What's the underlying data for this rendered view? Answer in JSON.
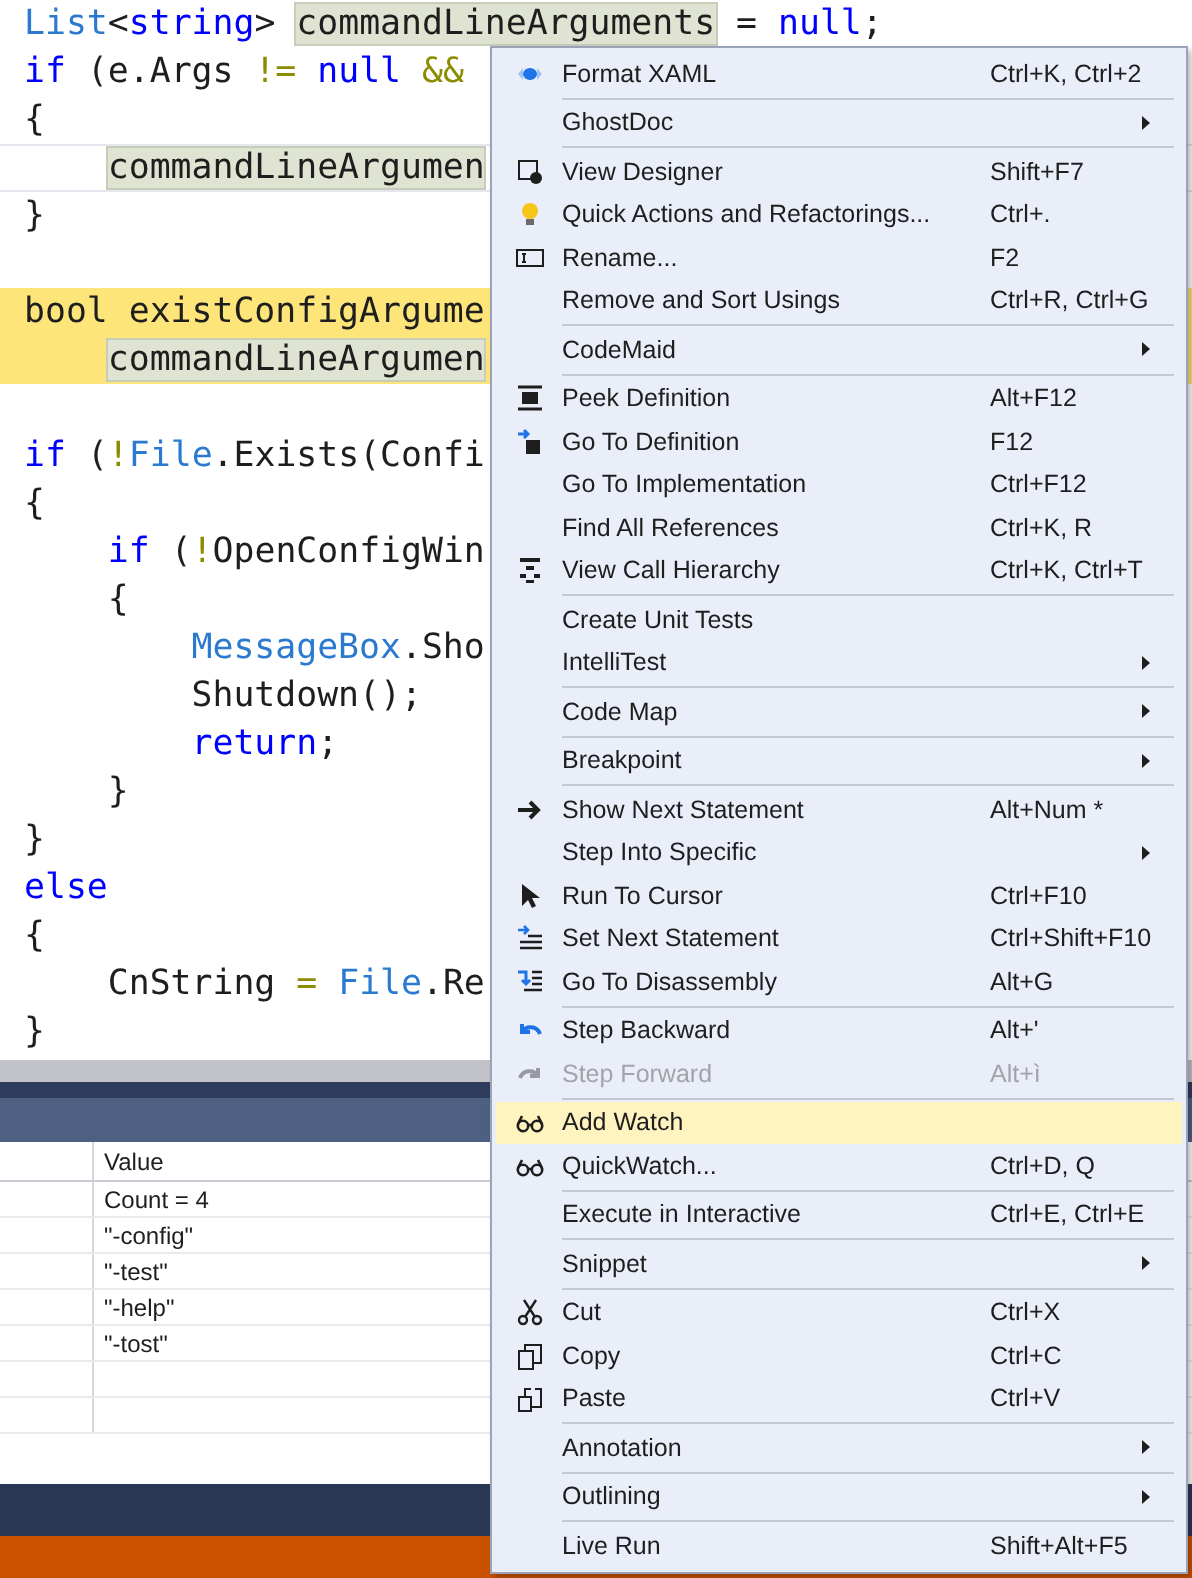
{
  "code_lines": [
    {
      "kind": "normal",
      "tokens": [
        {
          "text": "List",
          "kind": "type"
        },
        {
          "text": "<",
          "kind": "plain"
        },
        {
          "text": "string",
          "kind": "keyword"
        },
        {
          "text": "> ",
          "kind": "plain"
        },
        {
          "text": "commandLineArguments",
          "kind": "reference"
        },
        {
          "text": " = ",
          "kind": "plain"
        },
        {
          "text": "null",
          "kind": "keyword"
        },
        {
          "text": ";",
          "kind": "plain"
        }
      ]
    },
    {
      "kind": "normal",
      "tokens": [
        {
          "text": "if",
          "kind": "keyword"
        },
        {
          "text": " (e.Args ",
          "kind": "plain"
        },
        {
          "text": "!=",
          "kind": "operator"
        },
        {
          "text": " null ",
          "kind": "keyword"
        },
        {
          "text": "&&",
          "kind": "operator"
        }
      ]
    },
    {
      "kind": "normal",
      "tokens": [
        {
          "text": "{",
          "kind": "plain"
        }
      ]
    },
    {
      "kind": "caret",
      "tokens": [
        {
          "text": "    commandLineArgumen",
          "kind": "reference"
        }
      ]
    },
    {
      "kind": "normal",
      "tokens": [
        {
          "text": "}",
          "kind": "plain"
        }
      ]
    },
    {
      "kind": "normal"
    },
    {
      "kind": "breakpoint",
      "tokens": [
        {
          "text": "bool existConfigArgume",
          "kind": "plain"
        }
      ]
    },
    {
      "kind": "breakpoint",
      "tokens": [
        {
          "text": "    commandLineArgumen",
          "kind": "reference"
        }
      ]
    },
    {
      "kind": "normal"
    },
    {
      "kind": "normal",
      "tokens": [
        {
          "text": "if",
          "kind": "keyword"
        },
        {
          "text": " (",
          "kind": "plain"
        },
        {
          "text": "!",
          "kind": "operator"
        },
        {
          "text": "File",
          "kind": "type"
        },
        {
          "text": ".Exists(Confi",
          "kind": "plain"
        }
      ]
    },
    {
      "kind": "normal",
      "tokens": [
        {
          "text": "{",
          "kind": "plain"
        }
      ]
    },
    {
      "kind": "normal",
      "tokens": [
        {
          "text": "    if",
          "kind": "keyword"
        },
        {
          "text": " (",
          "kind": "plain"
        },
        {
          "text": "!",
          "kind": "operator"
        },
        {
          "text": "OpenConfigWin",
          "kind": "plain"
        }
      ]
    },
    {
      "kind": "normal",
      "tokens": [
        {
          "text": "    {",
          "kind": "plain"
        }
      ]
    },
    {
      "kind": "normal",
      "tokens": [
        {
          "text": "        MessageBox",
          "kind": "type"
        },
        {
          "text": ".Sho",
          "kind": "plain"
        }
      ]
    },
    {
      "kind": "normal",
      "tokens": [
        {
          "text": "        Shutdown();",
          "kind": "plain"
        }
      ]
    },
    {
      "kind": "normal",
      "tokens": [
        {
          "text": "        return",
          "kind": "keyword"
        },
        {
          "text": ";",
          "kind": "plain"
        }
      ]
    },
    {
      "kind": "normal",
      "tokens": [
        {
          "text": "    }",
          "kind": "plain"
        }
      ]
    },
    {
      "kind": "normal",
      "tokens": [
        {
          "text": "}",
          "kind": "plain"
        }
      ]
    },
    {
      "kind": "normal",
      "tokens": [
        {
          "text": "else",
          "kind": "keyword"
        }
      ]
    },
    {
      "kind": "normal",
      "tokens": [
        {
          "text": "{",
          "kind": "plain"
        }
      ]
    },
    {
      "kind": "normal",
      "tokens": [
        {
          "text": "    CnString ",
          "kind": "plain"
        },
        {
          "text": "=",
          "kind": "operator"
        },
        {
          "text": " File",
          "kind": "type"
        },
        {
          "text": ".Re",
          "kind": "plain"
        }
      ]
    },
    {
      "kind": "normal",
      "tokens": [
        {
          "text": "}",
          "kind": "plain"
        }
      ]
    }
  ],
  "watch": {
    "columns": [
      "Value"
    ],
    "rows": [
      "Count = 4",
      "\"-config\"",
      "\"-test\"",
      "\"-help\"",
      "\"-tost\""
    ]
  },
  "context_menu": [
    [
      {
        "label": "Format XAML",
        "shortcut": "Ctrl+K, Ctrl+2",
        "submenu": false,
        "disabled": false,
        "selected": false
      }
    ],
    [
      {
        "label": "GhostDoc",
        "submenu": true,
        "disabled": false,
        "selected": false
      }
    ],
    [
      {
        "label": "View Designer",
        "shortcut": "Shift+F7",
        "submenu": false,
        "disabled": false,
        "selected": false
      },
      {
        "label": "Quick Actions and Refactorings...",
        "shortcut": "Ctrl+.",
        "submenu": false,
        "disabled": false,
        "selected": false
      },
      {
        "label": "Rename...",
        "shortcut": "F2",
        "submenu": false,
        "disabled": false,
        "selected": false
      },
      {
        "label": "Remove and Sort Usings",
        "shortcut": "Ctrl+R, Ctrl+G",
        "submenu": false,
        "disabled": false,
        "selected": false
      }
    ],
    [
      {
        "label": "CodeMaid",
        "submenu": true,
        "disabled": false,
        "selected": false
      }
    ],
    [
      {
        "label": "Peek Definition",
        "shortcut": "Alt+F12",
        "submenu": false,
        "disabled": false,
        "selected": false
      },
      {
        "label": "Go To Definition",
        "shortcut": "F12",
        "submenu": false,
        "disabled": false,
        "selected": false
      },
      {
        "label": "Go To Implementation",
        "shortcut": "Ctrl+F12",
        "submenu": false,
        "disabled": false,
        "selected": false
      },
      {
        "label": "Find All References",
        "shortcut": "Ctrl+K, R",
        "submenu": false,
        "disabled": false,
        "selected": false
      },
      {
        "label": "View Call Hierarchy",
        "shortcut": "Ctrl+K, Ctrl+T",
        "submenu": false,
        "disabled": false,
        "selected": false
      }
    ],
    [
      {
        "label": "Create Unit Tests",
        "submenu": false,
        "disabled": false,
        "selected": false
      },
      {
        "label": "IntelliTest",
        "submenu": true,
        "disabled": false,
        "selected": false
      }
    ],
    [
      {
        "label": "Code Map",
        "submenu": true,
        "disabled": false,
        "selected": false
      }
    ],
    [
      {
        "label": "Breakpoint",
        "submenu": true,
        "disabled": false,
        "selected": false
      }
    ],
    [
      {
        "label": "Show Next Statement",
        "shortcut": "Alt+Num *",
        "submenu": false,
        "disabled": false,
        "selected": false
      },
      {
        "label": "Step Into Specific",
        "submenu": true,
        "disabled": false,
        "selected": false
      },
      {
        "label": "Run To Cursor",
        "shortcut": "Ctrl+F10",
        "submenu": false,
        "disabled": false,
        "selected": false
      },
      {
        "label": "Set Next Statement",
        "shortcut": "Ctrl+Shift+F10",
        "submenu": false,
        "disabled": false,
        "selected": false
      },
      {
        "label": "Go To Disassembly",
        "shortcut": "Alt+G",
        "submenu": false,
        "disabled": false,
        "selected": false
      }
    ],
    [
      {
        "label": "Step Backward",
        "shortcut": "Alt+'",
        "submenu": false,
        "disabled": false,
        "selected": false
      },
      {
        "label": "Step Forward",
        "shortcut": "Alt+ì",
        "submenu": false,
        "disabled": true,
        "selected": false
      }
    ],
    [
      {
        "label": "Add Watch",
        "submenu": false,
        "disabled": false,
        "selected": true
      },
      {
        "label": "QuickWatch...",
        "shortcut": "Ctrl+D, Q",
        "submenu": false,
        "disabled": false,
        "selected": false
      }
    ],
    [
      {
        "label": "Execute in Interactive",
        "shortcut": "Ctrl+E, Ctrl+E",
        "submenu": false,
        "disabled": false,
        "selected": false
      }
    ],
    [
      {
        "label": "Snippet",
        "submenu": true,
        "disabled": false,
        "selected": false
      }
    ],
    [
      {
        "label": "Cut",
        "shortcut": "Ctrl+X",
        "submenu": false,
        "disabled": false,
        "selected": false
      },
      {
        "label": "Copy",
        "shortcut": "Ctrl+C",
        "submenu": false,
        "disabled": false,
        "selected": false
      },
      {
        "label": "Paste",
        "shortcut": "Ctrl+V",
        "submenu": false,
        "disabled": false,
        "selected": false
      }
    ],
    [
      {
        "label": "Annotation",
        "submenu": true,
        "disabled": false,
        "selected": false
      }
    ],
    [
      {
        "label": "Outlining",
        "submenu": true,
        "disabled": false,
        "selected": false
      }
    ],
    [
      {
        "label": "Live Run",
        "shortcut": "Shift+Alt+F5",
        "submenu": false,
        "disabled": false,
        "selected": false
      }
    ]
  ]
}
